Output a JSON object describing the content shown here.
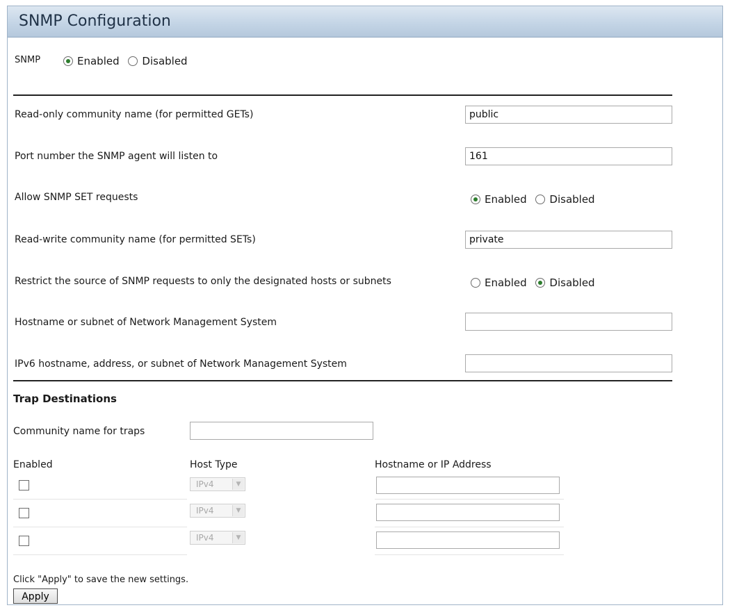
{
  "header": {
    "title": "SNMP Configuration"
  },
  "snmp": {
    "label": "SNMP",
    "options": [
      "Enabled",
      "Disabled"
    ],
    "selected": "Enabled"
  },
  "settings": {
    "read_only_community": {
      "label": "Read-only community name (for permitted GETs)",
      "value": "public"
    },
    "port": {
      "label": "Port number the SNMP agent will listen to",
      "value": "161"
    },
    "allow_set": {
      "label": "Allow SNMP SET requests",
      "options": [
        "Enabled",
        "Disabled"
      ],
      "selected": "Enabled"
    },
    "read_write_community": {
      "label": "Read-write community name (for permitted SETs)",
      "value": "private"
    },
    "restrict_source": {
      "label": "Restrict the source of SNMP requests to only the designated hosts or subnets",
      "options": [
        "Enabled",
        "Disabled"
      ],
      "selected": "Disabled"
    },
    "nms_hostname": {
      "label": "Hostname or subnet of Network Management System",
      "value": ""
    },
    "nms_ipv6": {
      "label": "IPv6 hostname, address, or subnet of Network Management System",
      "value": ""
    }
  },
  "traps": {
    "title": "Trap Destinations",
    "community_label": "Community name for traps",
    "community_value": "",
    "columns": {
      "enabled": "Enabled",
      "host_type": "Host Type",
      "address": "Hostname or IP Address"
    },
    "rows": [
      {
        "enabled": false,
        "host_type": "IPv4",
        "address": ""
      },
      {
        "enabled": false,
        "host_type": "IPv4",
        "address": ""
      },
      {
        "enabled": false,
        "host_type": "IPv4",
        "address": ""
      }
    ]
  },
  "footer": {
    "hint": "Click \"Apply\" to save the new settings.",
    "apply_label": "Apply"
  },
  "icons": {
    "radio_checked_color": "#2d7d2d",
    "select_arrow": "chevron-down-icon"
  },
  "colors": {
    "title_bar_top": "#dde7f1",
    "title_bar_bottom": "#b5c8dc",
    "title_text": "#1f3146"
  }
}
